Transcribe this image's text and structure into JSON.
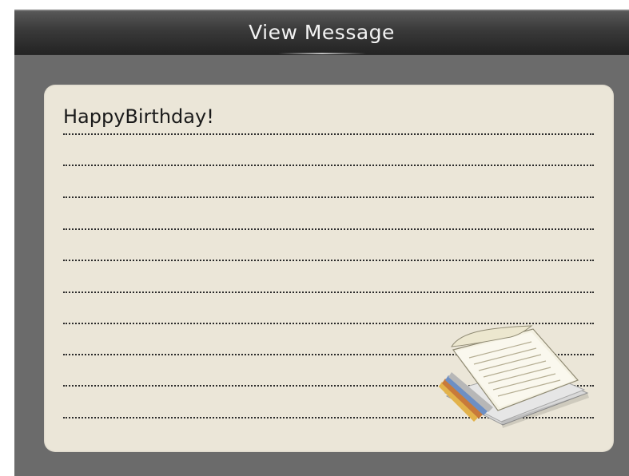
{
  "header": {
    "title": "View Message"
  },
  "message": {
    "text": "HappyBirthday!",
    "line_count": 10
  },
  "icons": {
    "note": "note-paper-icon"
  },
  "colors": {
    "header_dark": "#232323",
    "background": "#6b6b6b",
    "paper": "#ebe6d8",
    "title_text": "#f2f2f2"
  }
}
